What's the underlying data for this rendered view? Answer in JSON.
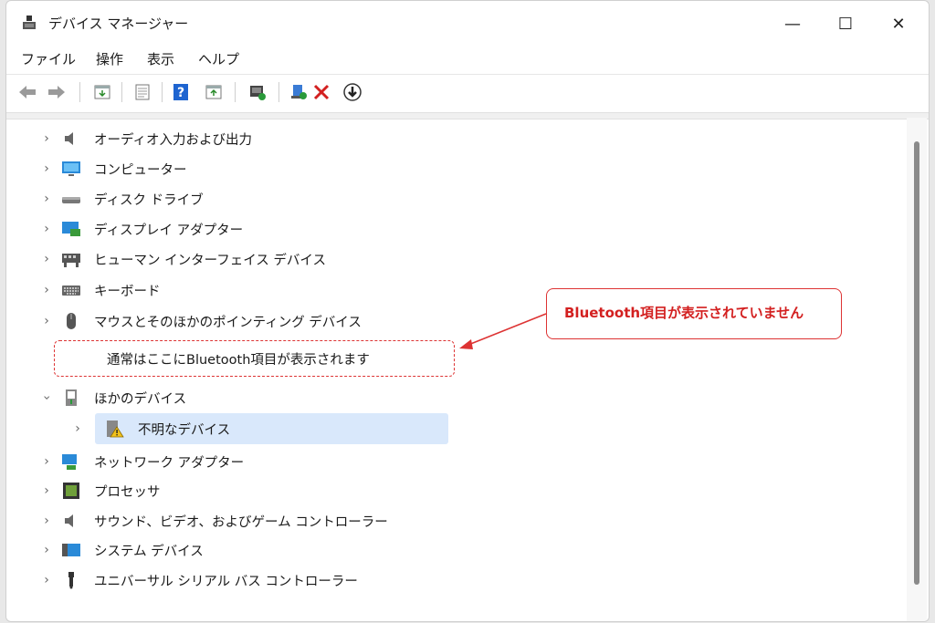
{
  "window": {
    "title": "デバイス マネージャー",
    "minimize": "—",
    "maximize": "☐",
    "close": "✕"
  },
  "menu": [
    "ファイル",
    "操作",
    "表示",
    "ヘルプ"
  ],
  "toolbar": {
    "icons": [
      "back-arrow-icon",
      "forward-arrow-icon",
      "properties-icon",
      "update-driver-icon",
      "help-icon",
      "scan-hardware-icon",
      "display-adapter-icon",
      "uninstall-device-icon",
      "remove-x-icon",
      "download-icon"
    ]
  },
  "tree": {
    "items": [
      {
        "label": "オーディオ入力および出力",
        "icon": "speaker-icon",
        "expanded": false
      },
      {
        "label": "コンピューター",
        "icon": "monitor-icon",
        "expanded": false
      },
      {
        "label": "ディスク ドライブ",
        "icon": "disk-drive-icon",
        "expanded": false
      },
      {
        "label": "ディスプレイ アダプター",
        "icon": "display-adapter-icon",
        "expanded": false
      },
      {
        "label": "ヒューマン インターフェイス デバイス",
        "icon": "hid-icon",
        "expanded": false
      },
      {
        "label": "キーボード",
        "icon": "keyboard-icon",
        "expanded": false
      },
      {
        "label": "マウスとそのほかのポインティング デバイス",
        "icon": "mouse-icon",
        "expanded": false
      },
      {
        "label": "ほかのデバイス",
        "icon": "other-device-icon",
        "expanded": true
      },
      {
        "label": "不明なデバイス",
        "icon": "unknown-device-warning-icon",
        "child": true,
        "selected": true
      },
      {
        "label": "ネットワーク アダプター",
        "icon": "network-icon",
        "expanded": false
      },
      {
        "label": "プロセッサ",
        "icon": "processor-icon",
        "expanded": false
      },
      {
        "label": "サウンド、ビデオ、およびゲーム コントローラー",
        "icon": "speaker-icon",
        "expanded": false
      },
      {
        "label": "システム デバイス",
        "icon": "system-icon",
        "expanded": false
      },
      {
        "label": "ユニバーサル シリアル バス コントローラー",
        "icon": "usb-icon",
        "expanded": false
      }
    ]
  },
  "annotations": {
    "placeholder_text": "通常はここにBluetooth項目が表示されます",
    "note_text": "Bluetooth項目が表示されていません"
  },
  "colors": {
    "accent_red": "#d32020",
    "selection": "#d9e8fb"
  }
}
